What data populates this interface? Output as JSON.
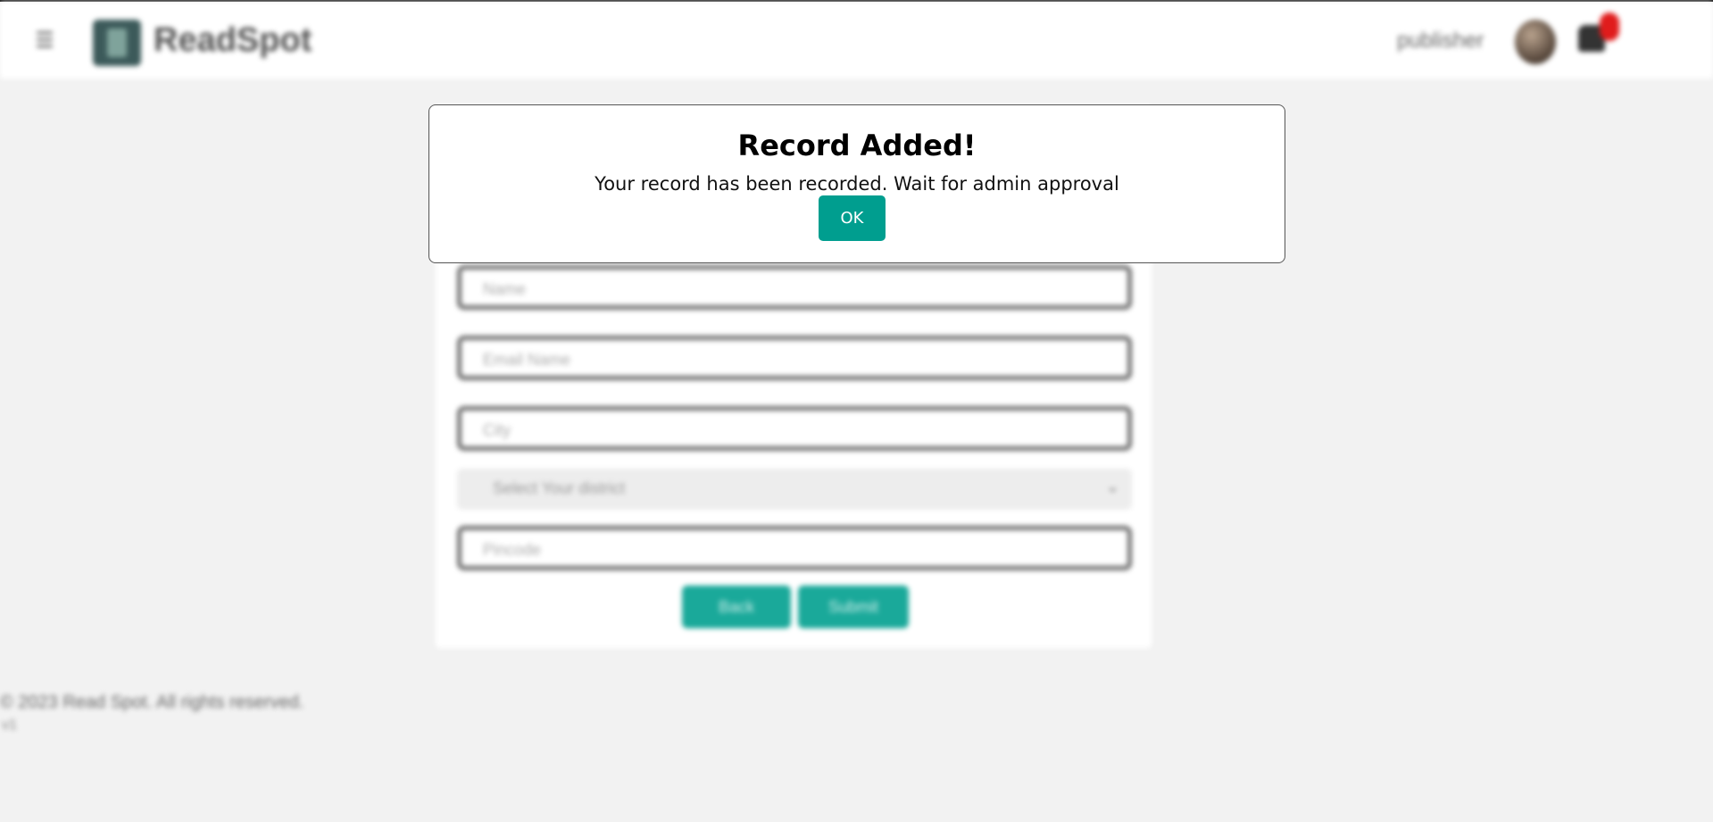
{
  "header": {
    "menu_icon": "hamburger-icon",
    "brand": "ReadSpot",
    "user_label": "publisher",
    "notification_icon": "bell-icon"
  },
  "form": {
    "fields": [
      {
        "placeholder": "Name"
      },
      {
        "placeholder": "Email Name"
      },
      {
        "placeholder": "City"
      },
      {
        "placeholder": "Pincode"
      }
    ],
    "district_select": "Select Your district",
    "back_label": "Back",
    "submit_label": "Submit"
  },
  "footer": {
    "copyright": "© 2023 Read Spot. All rights reserved.",
    "version": "v1"
  },
  "modal": {
    "title": "Record Added!",
    "message": "Your record has been recorded. Wait for admin approval",
    "ok_label": "OK",
    "accent_color": "#009e8f"
  }
}
